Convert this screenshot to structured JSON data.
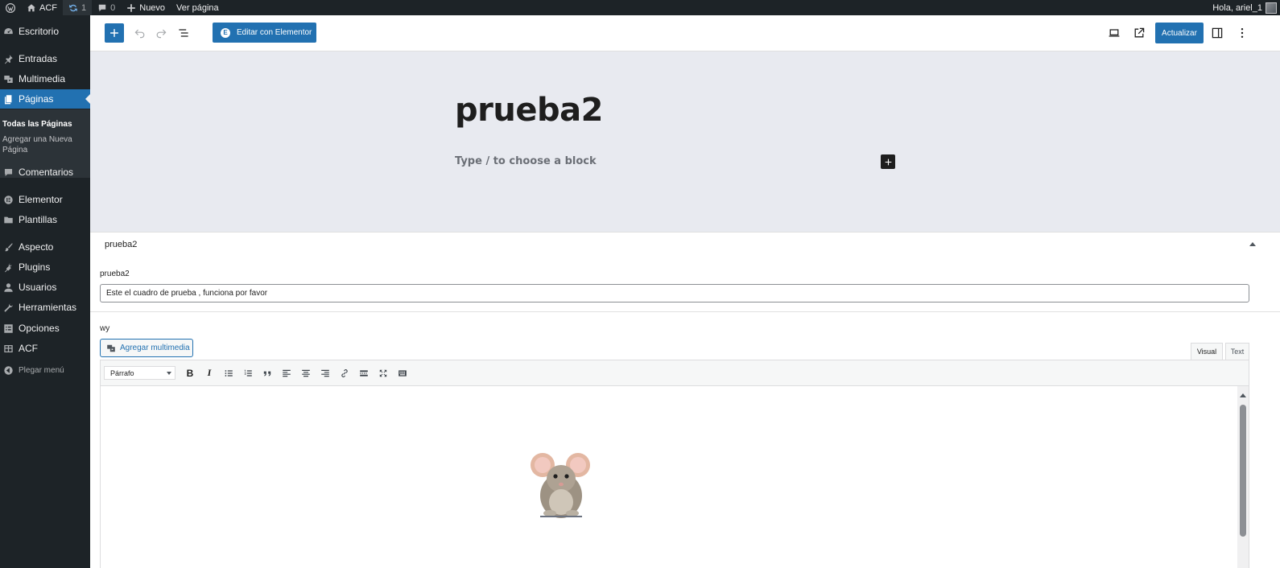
{
  "admin_bar": {
    "site_name": "ACF",
    "updates_count": "1",
    "comments_count": "0",
    "new_label": "Nuevo",
    "view_page_label": "Ver página",
    "greeting": "Hola, ariel_1"
  },
  "sidebar": {
    "items": [
      {
        "label": "Escritorio",
        "icon": "dashboard-icon"
      },
      {
        "label": "Entradas",
        "icon": "pin-icon"
      },
      {
        "label": "Multimedia",
        "icon": "media-icon"
      },
      {
        "label": "Páginas",
        "icon": "pages-icon"
      },
      {
        "label": "Comentarios",
        "icon": "comment-icon"
      },
      {
        "label": "Elementor",
        "icon": "elementor-icon"
      },
      {
        "label": "Plantillas",
        "icon": "folder-icon"
      },
      {
        "label": "Aspecto",
        "icon": "brush-icon"
      },
      {
        "label": "Plugins",
        "icon": "plugin-icon"
      },
      {
        "label": "Usuarios",
        "icon": "user-icon"
      },
      {
        "label": "Herramientas",
        "icon": "wrench-icon"
      },
      {
        "label": "Opciones",
        "icon": "settings-icon"
      },
      {
        "label": "ACF",
        "icon": "acf-icon"
      }
    ],
    "submenu": [
      "Todas las Páginas",
      "Agregar una Nueva Página"
    ],
    "collapse_label": "Plegar menú"
  },
  "header": {
    "elementor_button": "Editar con Elementor",
    "update_button": "Actualizar"
  },
  "canvas": {
    "title": "prueba2",
    "placeholder": "Type / to choose a block"
  },
  "metabox": {
    "title": "prueba2",
    "field1_label": "prueba2",
    "field1_value": "Este el cuadro de prueba , funciona por favor",
    "field2_label": "wy",
    "add_media_label": "Agregar multimedia",
    "tab_visual": "Visual",
    "tab_text": "Text",
    "format_selected": "Párrafo"
  },
  "colors": {
    "accent": "#2271b1",
    "admin_dark": "#1d2327",
    "canvas_bg": "#e8eaf0"
  }
}
